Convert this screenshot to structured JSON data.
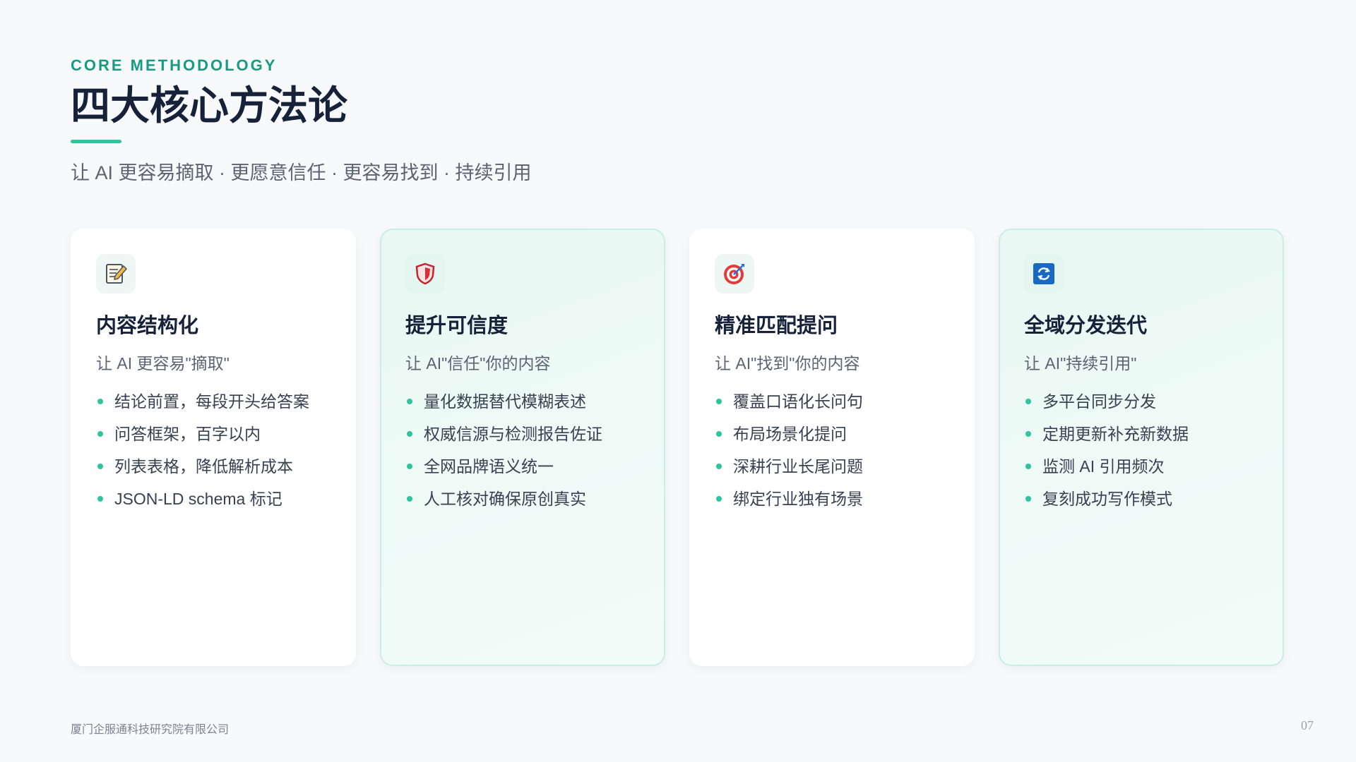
{
  "header": {
    "eyebrow": "CORE METHODOLOGY",
    "title": "四大核心方法论",
    "subtitle": "让 AI 更容易摘取 · 更愿意信任 · 更容易找到 · 持续引用"
  },
  "cards": [
    {
      "icon": "memo-icon",
      "title": "内容结构化",
      "subtitle": "让 AI 更容易\"摘取\"",
      "points": [
        "结论前置，每段开头给答案",
        "问答框架，百字以内",
        "列表表格，降低解析成本",
        "JSON-LD schema 标记"
      ]
    },
    {
      "icon": "shield-icon",
      "title": "提升可信度",
      "subtitle": "让 AI\"信任\"你的内容",
      "points": [
        "量化数据替代模糊表述",
        "权威信源与检测报告佐证",
        "全网品牌语义统一",
        "人工核对确保原创真实"
      ]
    },
    {
      "icon": "target-icon",
      "title": "精准匹配提问",
      "subtitle": "让 AI\"找到\"你的内容",
      "points": [
        "覆盖口语化长问句",
        "布局场景化提问",
        "深耕行业长尾问题",
        "绑定行业独有场景"
      ]
    },
    {
      "icon": "refresh-icon",
      "title": "全域分发迭代",
      "subtitle": "让 AI\"持续引用\"",
      "points": [
        "多平台同步分发",
        "定期更新补充新数据",
        "监测 AI 引用频次",
        "复刻成功写作模式"
      ]
    }
  ],
  "footer": {
    "company": "厦门企服通科技研究院有限公司",
    "page_number": "07"
  },
  "colors": {
    "accent": "#2ec4a0",
    "eyebrow": "#179c82",
    "title": "#16213a",
    "card_tint": "#e9f8f3"
  }
}
